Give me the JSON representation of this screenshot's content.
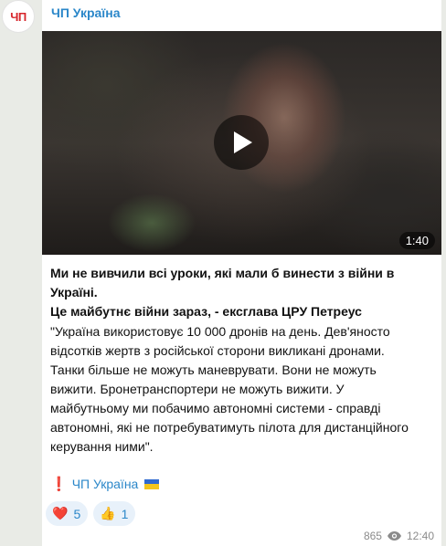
{
  "channel": {
    "name": "ЧП Україна",
    "avatar_text": "ЧП"
  },
  "video": {
    "duration": "1:40"
  },
  "post": {
    "headline_line1": "Ми не вивчили всі уроки, які мали б винести з війни в Україні.",
    "headline_line2": "Це майбутнє війни зараз, - ексглава ЦРУ Петреус",
    "body_line1": "\"Україна використовує 10 000 дронів на день. Дев'яносто",
    "body_line2": "відсотків жертв з російської сторони викликані дронами.",
    "body_line3": "Танки більше не можуть маневрувати. Вони не можуть",
    "body_line4": "вижити. Бронетранспортери не можуть вижити. У",
    "body_line5": "майбутньому ми побачимо автономні системи - справді",
    "body_line6": "автономні, які не потребуватимуть пілота для дистанційного",
    "body_line7": "керування ними\".",
    "signature_mark": "❗",
    "signature_text": "ЧП Україна"
  },
  "reactions": [
    {
      "icon": "heart-icon",
      "emoji": "❤️",
      "count": "5"
    },
    {
      "icon": "thumbs-up-icon",
      "emoji": "👍",
      "count": "1"
    }
  ],
  "meta": {
    "views": "865",
    "time": "12:40"
  },
  "colors": {
    "accent": "#2b87c9",
    "avatar_text": "#d7252b",
    "background": "#e9ebe6"
  }
}
